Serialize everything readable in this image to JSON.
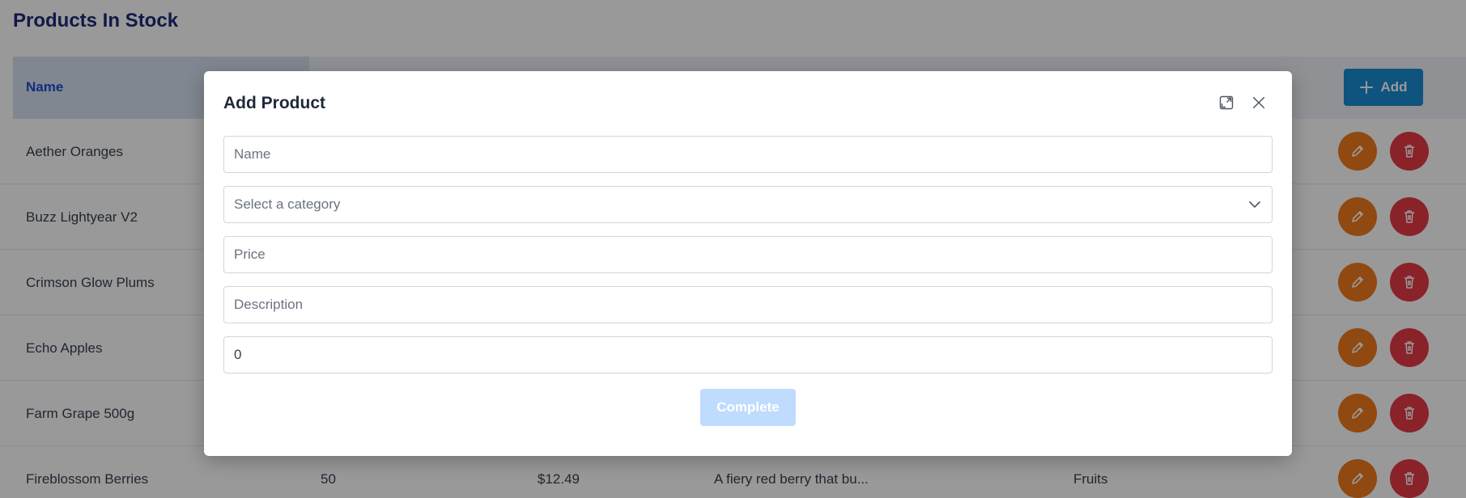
{
  "page": {
    "title": "Products In Stock"
  },
  "table": {
    "header": {
      "name": "Name"
    },
    "add_label": "Add",
    "rows": [
      {
        "name": "Aether Oranges",
        "stock": "",
        "price": "",
        "description": "",
        "category": ""
      },
      {
        "name": "Buzz Lightyear V2",
        "stock": "",
        "price": "",
        "description": "",
        "category": ""
      },
      {
        "name": "Crimson Glow Plums",
        "stock": "",
        "price": "",
        "description": "",
        "category": ""
      },
      {
        "name": "Echo Apples",
        "stock": "",
        "price": "",
        "description": "",
        "category": ""
      },
      {
        "name": "Farm Grape 500g",
        "stock": "",
        "price": "",
        "description": "",
        "category": ""
      },
      {
        "name": "Fireblossom Berries",
        "stock": "50",
        "price": "$12.49",
        "description": "A fiery red berry that bu...",
        "category": "Fruits"
      }
    ]
  },
  "modal": {
    "title": "Add Product",
    "name_placeholder": "Name",
    "category_placeholder": "Select a category",
    "price_placeholder": "Price",
    "description_placeholder": "Description",
    "quantity_value": "0",
    "complete_label": "Complete"
  },
  "colors": {
    "title": "#1e2a78",
    "header_accent": "#1d4ed8",
    "add_button": "#1a8ad4",
    "edit_button": "#f07a1c",
    "delete_button": "#e63946",
    "complete_disabled": "#bfdbfe"
  },
  "icons": [
    "plus-icon",
    "pencil-icon",
    "trash-icon",
    "expand-icon",
    "close-icon",
    "chevron-down-icon"
  ]
}
